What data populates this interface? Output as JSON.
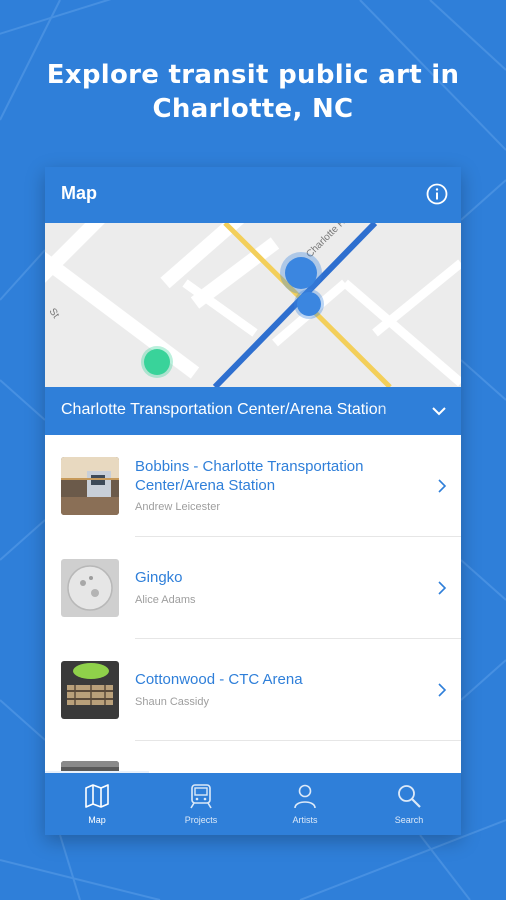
{
  "headline": {
    "line1": "Explore transit public art in",
    "line2": "Charlotte, NC"
  },
  "appbar": {
    "title": "Map",
    "info_icon": "info-icon"
  },
  "map": {
    "street_labels": [
      "Charlotte Ra",
      "St"
    ],
    "colors": {
      "light_rail": "#2e6fcf",
      "street_yellow": "#f3cf5a",
      "marker_blue": "#3b86e0",
      "marker_green": "#39d39a"
    }
  },
  "station": {
    "name": "Charlotte Transportation Center/Arena Station",
    "icon": "chevron-down-icon"
  },
  "artworks": [
    {
      "title": "Bobbins - Charlotte Transportation Center/Arena Station",
      "artist": "Andrew Leicester"
    },
    {
      "title": "Gingko",
      "artist": "Alice Adams"
    },
    {
      "title": "Cottonwood - CTC Arena",
      "artist": "Shaun Cassidy"
    }
  ],
  "tabs": [
    {
      "label": "Map",
      "icon": "map-icon",
      "selected": true
    },
    {
      "label": "Projects",
      "icon": "train-icon",
      "selected": false
    },
    {
      "label": "Artists",
      "icon": "person-icon",
      "selected": false
    },
    {
      "label": "Search",
      "icon": "search-icon",
      "selected": false
    }
  ],
  "colors": {
    "primary": "#2f7fd9",
    "link": "#2f7fd9",
    "muted": "#9e9e9e"
  }
}
